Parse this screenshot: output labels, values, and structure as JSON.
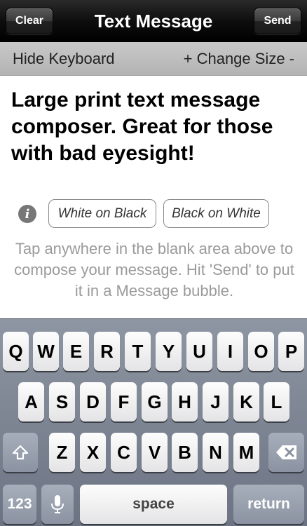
{
  "navbar": {
    "clear_label": "Clear",
    "title": "Text Message",
    "send_label": "Send"
  },
  "toolbar": {
    "hide_keyboard": "Hide Keyboard",
    "change_size": "+ Change Size -"
  },
  "message": "Large print text message composer. Great for those with bad eyesight!",
  "info_icon": "i",
  "themes": {
    "white_on_black": "White on Black",
    "black_on_white": "Black on White"
  },
  "hint": "Tap anywhere in the blank area above to compose your message. Hit 'Send' to put it in a Message bubble.",
  "keyboard": {
    "row1": [
      "Q",
      "W",
      "E",
      "R",
      "T",
      "Y",
      "U",
      "I",
      "O",
      "P"
    ],
    "row2": [
      "A",
      "S",
      "D",
      "F",
      "G",
      "H",
      "J",
      "K",
      "L"
    ],
    "row3": [
      "Z",
      "X",
      "C",
      "V",
      "B",
      "N",
      "M"
    ],
    "numbers_key": "123",
    "space_key": "space",
    "return_key": "return",
    "icons": {
      "shift": "shift-icon",
      "delete": "delete-icon",
      "mic": "microphone-icon"
    }
  }
}
